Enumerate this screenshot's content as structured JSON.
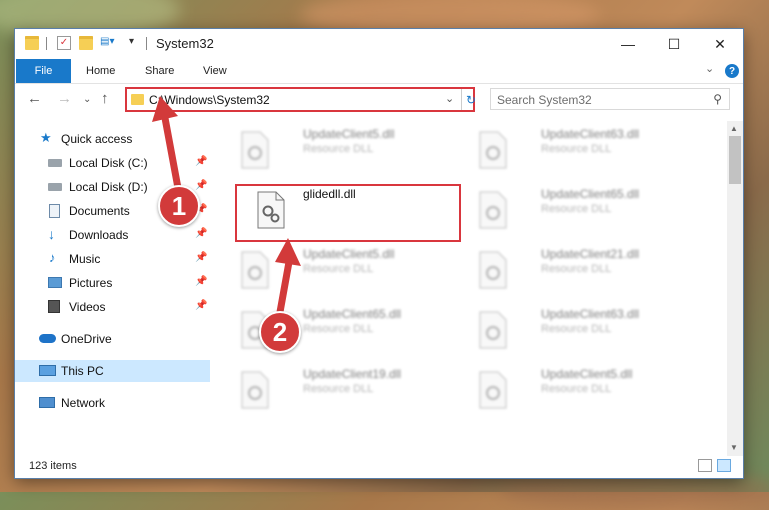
{
  "window": {
    "title": "System32",
    "controls": {
      "minimize": "—",
      "maximize": "☐",
      "close": "✕"
    }
  },
  "ribbon": {
    "tabs": [
      "File",
      "Home",
      "Share",
      "View"
    ],
    "help": "?"
  },
  "navigation": {
    "address": "C:\\Windows\\System32",
    "search_placeholder": "Search System32"
  },
  "sidebar": {
    "items": [
      {
        "label": "Quick access",
        "icon": "star-icon"
      },
      {
        "label": "Local Disk (C:)",
        "icon": "drive-icon",
        "pinned": true
      },
      {
        "label": "Local Disk (D:)",
        "icon": "drive-icon",
        "pinned": true
      },
      {
        "label": "Documents",
        "icon": "documents-icon",
        "pinned": true
      },
      {
        "label": "Downloads",
        "icon": "download-icon",
        "pinned": true
      },
      {
        "label": "Music",
        "icon": "music-icon",
        "pinned": true
      },
      {
        "label": "Pictures",
        "icon": "pictures-icon",
        "pinned": true
      },
      {
        "label": "Videos",
        "icon": "videos-icon",
        "pinned": true
      },
      {
        "label": "OneDrive",
        "icon": "cloud-icon"
      },
      {
        "label": "This PC",
        "icon": "computer-icon",
        "selected": true
      },
      {
        "label": "Network",
        "icon": "network-icon"
      }
    ]
  },
  "files": {
    "left": [
      {
        "name": "UpdateClient5.dll",
        "desc": "Resource DLL"
      },
      {
        "name": "glidedll.dll",
        "desc": ""
      },
      {
        "name": "UpdateClient5.dll",
        "desc": "Resource DLL"
      },
      {
        "name": "UpdateClient65.dll",
        "desc": "Resource DLL"
      },
      {
        "name": "UpdateClient19.dll",
        "desc": "Resource DLL"
      }
    ],
    "right": [
      {
        "name": "UpdateClient63.dll",
        "desc": "Resource DLL"
      },
      {
        "name": "UpdateClient65.dll",
        "desc": "Resource DLL"
      },
      {
        "name": "UpdateClient21.dll",
        "desc": "Resource DLL"
      },
      {
        "name": "UpdateClient63.dll",
        "desc": "Resource DLL"
      },
      {
        "name": "UpdateClient5.dll",
        "desc": "Resource DLL"
      }
    ]
  },
  "status": {
    "item_count": "123 items"
  },
  "annotations": {
    "step1": "1",
    "step2": "2"
  },
  "colors": {
    "accent": "#1979ca",
    "highlight": "#d9363e",
    "badge": "#d23a3a"
  }
}
